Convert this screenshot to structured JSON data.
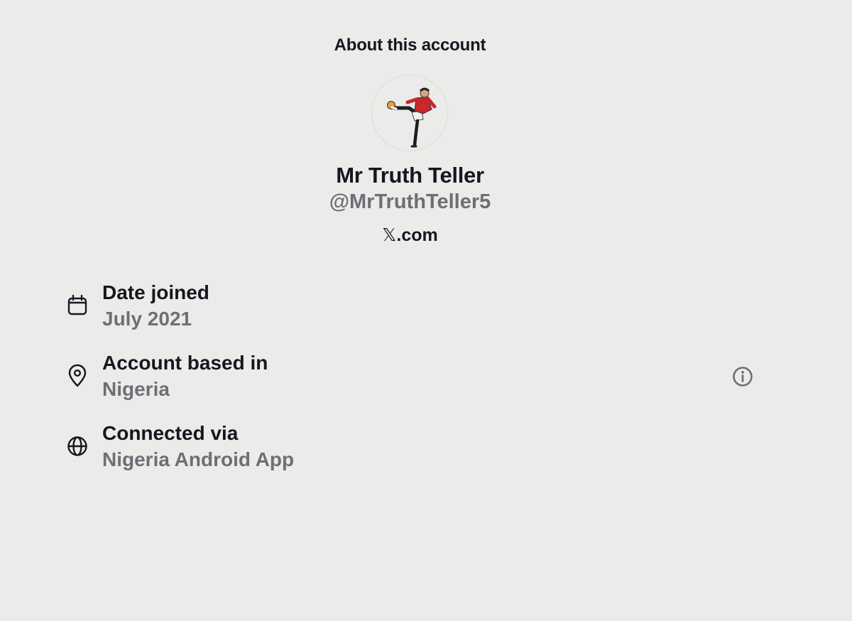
{
  "header": {
    "title": "About this account"
  },
  "profile": {
    "display_name": "Mr Truth Teller",
    "handle": "@MrTruthTeller5",
    "site_glyph": "𝕏",
    "site_suffix": ".com",
    "avatar_icon": "footballer-avatar"
  },
  "details": {
    "date_joined": {
      "icon": "calendar-icon",
      "label": "Date joined",
      "value": "July 2021"
    },
    "based_in": {
      "icon": "location-pin-icon",
      "label": "Account based in",
      "value": "Nigeria"
    },
    "connected_via": {
      "icon": "globe-icon",
      "label": "Connected via",
      "value": "Nigeria Android App"
    },
    "info_icon": "info-icon"
  },
  "colors": {
    "background": "#ecebe9",
    "primary_text": "#14171f",
    "secondary_text": "#6b7076"
  }
}
